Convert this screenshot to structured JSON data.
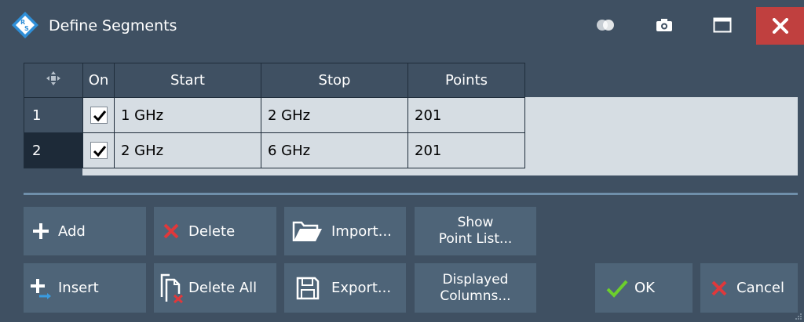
{
  "window": {
    "title": "Define Segments"
  },
  "table": {
    "columns": [
      "On",
      "Start",
      "Stop",
      "Points"
    ],
    "rows": [
      {
        "index": "1",
        "on": true,
        "start": "1 GHz",
        "stop": "2 GHz",
        "points": "201"
      },
      {
        "index": "2",
        "on": true,
        "start": "2 GHz",
        "stop": "6 GHz",
        "points": "201"
      }
    ]
  },
  "buttons": {
    "add": "Add",
    "delete": "Delete",
    "import": "Import...",
    "show_point_list_1": "Show",
    "show_point_list_2": "Point List...",
    "insert": "Insert",
    "delete_all": "Delete All",
    "export": "Export...",
    "displayed_columns_1": "Displayed",
    "displayed_columns_2": "Columns...",
    "ok": "OK",
    "cancel": "Cancel"
  },
  "colors": {
    "background": "#3f5062",
    "button": "#4e6478",
    "close": "#c0403f",
    "table_cell": "#d6dde3",
    "ok_check": "#6ccf2c",
    "cancel_x": "#e0383b"
  }
}
